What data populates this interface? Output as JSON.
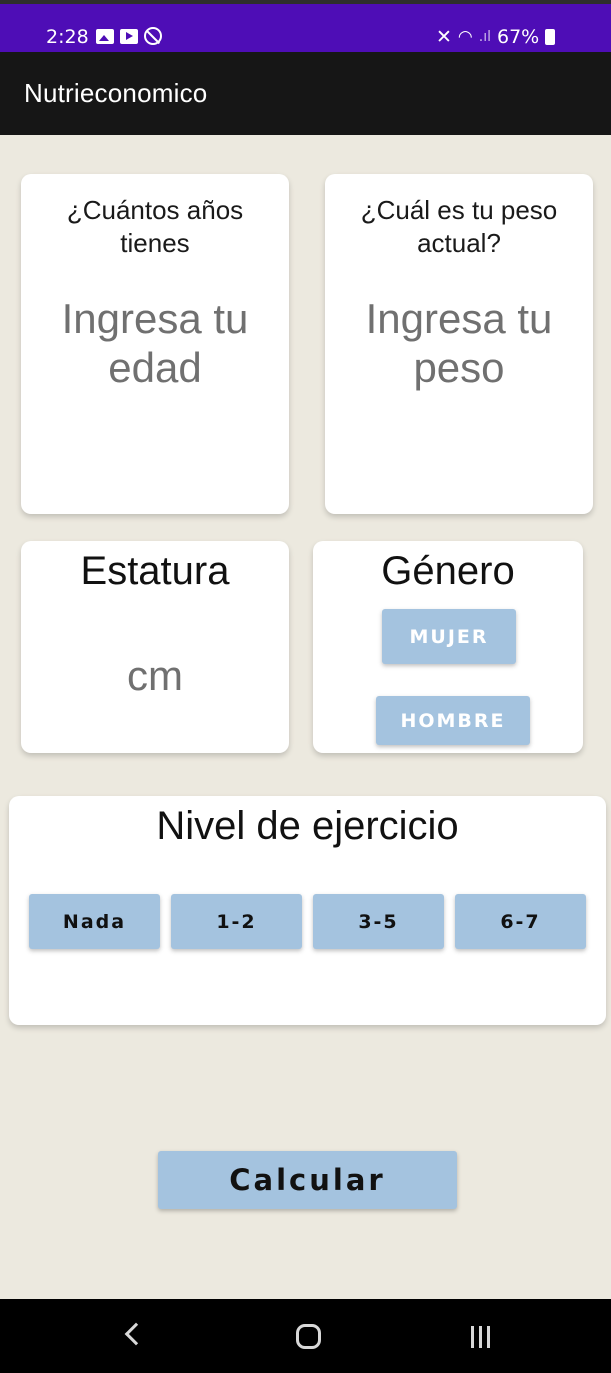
{
  "status_bar": {
    "time": "2:28",
    "battery": "67%",
    "background": "#4E0DB6"
  },
  "app_bar": {
    "title": "Nutrieconomico"
  },
  "age_card": {
    "question_line1": "¿Cuántos años",
    "question_line2": "tienes",
    "placeholder_line1": "Ingresa tu",
    "placeholder_line2": "edad"
  },
  "weight_card": {
    "question_line1": "¿Cuál es tu peso",
    "question_line2": "actual?",
    "placeholder_line1": "Ingresa tu",
    "placeholder_line2": "peso"
  },
  "height_card": {
    "title": "Estatura",
    "unit": "cm"
  },
  "gender_card": {
    "title": "Género",
    "options": [
      "MUJER",
      "HOMBRE"
    ]
  },
  "exercise_card": {
    "title": "Nivel de ejercicio",
    "options": [
      "Nada",
      "1-2",
      "3-5",
      "6-7"
    ]
  },
  "calculate_button": "Calcular",
  "colors": {
    "background": "#ECE9DF",
    "app_bar": "#161616",
    "button": "#A4C3DF"
  }
}
